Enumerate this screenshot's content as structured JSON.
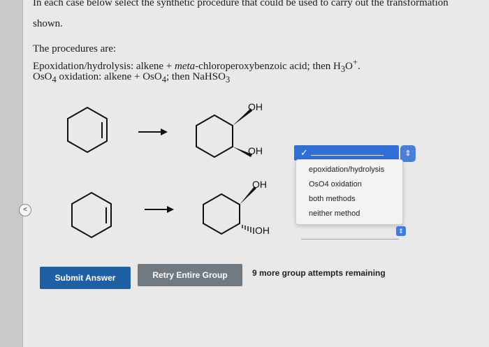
{
  "question": {
    "line1": "In each case below select the synthetic procedure that could be used to carry out the transformation",
    "line2": "shown."
  },
  "procedures": {
    "heading": "The procedures are:",
    "epoxidation": {
      "label": "Epoxidation/hydrolysis: alkene + ",
      "reagent": "meta",
      "rest": "-chloroperoxybenzoic acid; then H",
      "sub3": "3",
      "o": "O",
      "plus": "+",
      "end": "."
    },
    "oso4": {
      "a": "OsO",
      "sub4a": "4",
      "b": " oxidation: alkene + OsO",
      "sub4b": "4",
      "c": "; then NaHSO",
      "sub3": "3"
    }
  },
  "reactions": {
    "r1_oh_top": "OH",
    "r1_oh_bottom": "OH",
    "r2_oh_top": "OH",
    "r2_oh_bottom": "OH",
    "r2_hash": "''''"
  },
  "dropdown": {
    "check": "✓",
    "options": [
      "epoxidation/hydrolysis",
      "OsO4 oxidation",
      "both methods",
      "neither method"
    ]
  },
  "buttons": {
    "submit": "Submit Answer",
    "retry": "Retry Entire Group"
  },
  "attempts": "9 more group attempts remaining",
  "colors": {
    "submit": "#1f5fa3",
    "retry": "#707a80",
    "dropdown_accent": "#2f6fd6"
  }
}
